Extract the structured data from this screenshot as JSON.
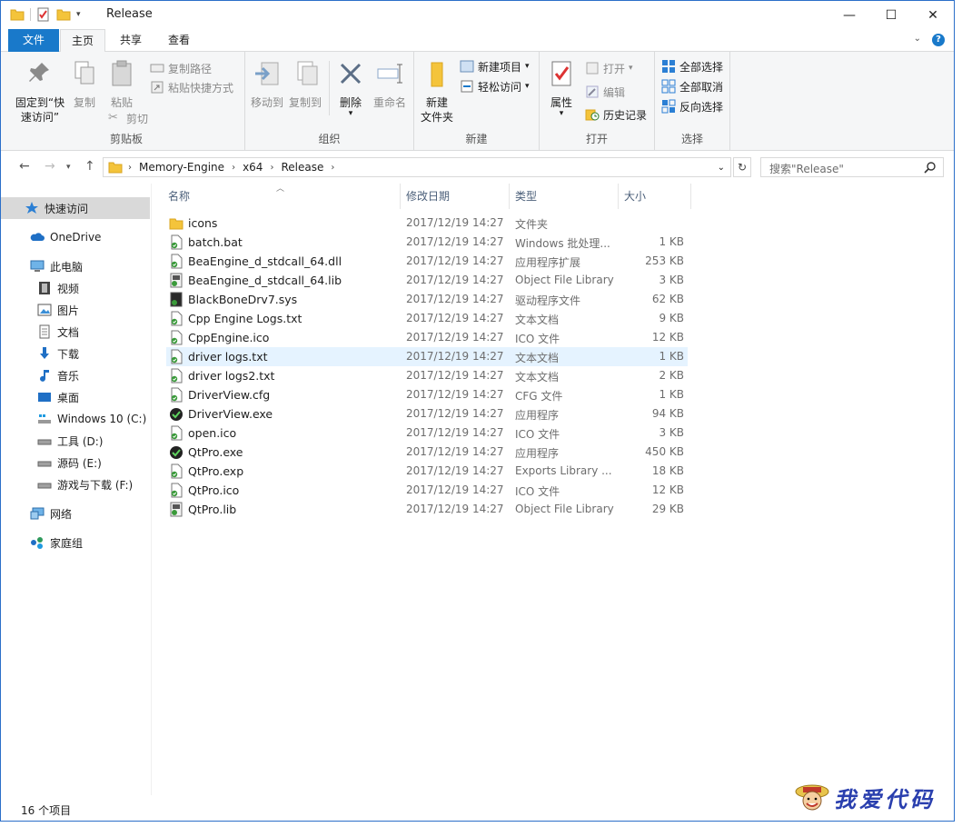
{
  "window": {
    "title": "Release"
  },
  "ribbon_tabs": {
    "file": "文件",
    "home": "主页",
    "share": "共享",
    "view": "查看"
  },
  "ribbon": {
    "clipboard": {
      "label": "剪贴板",
      "pin_line1": "固定到“快",
      "pin_line2": "速访问”",
      "copy": "复制",
      "paste": "粘贴",
      "copy_path": "复制路径",
      "paste_shortcut": "粘贴快捷方式",
      "cut": "剪切"
    },
    "organize": {
      "label": "组织",
      "move_to": "移动到",
      "copy_to": "复制到",
      "delete": "删除",
      "rename": "重命名"
    },
    "new": {
      "label": "新建",
      "new_folder_line1": "新建",
      "new_folder_line2": "文件夹",
      "new_item": "新建项目",
      "easy_access": "轻松访问"
    },
    "open": {
      "label": "打开",
      "properties": "属性",
      "open": "打开",
      "edit": "编辑",
      "history": "历史记录"
    },
    "select": {
      "label": "选择",
      "select_all": "全部选择",
      "select_none": "全部取消",
      "invert": "反向选择"
    }
  },
  "address": {
    "crumbs": [
      "Memory-Engine",
      "x64",
      "Release"
    ],
    "search_placeholder": "搜索\"Release\""
  },
  "nav": {
    "quick_access": "快速访问",
    "onedrive": "OneDrive",
    "this_pc": "此电脑",
    "videos": "视频",
    "pictures": "图片",
    "documents": "文档",
    "downloads": "下载",
    "music": "音乐",
    "desktop": "桌面",
    "drive_c": "Windows 10 (C:)",
    "drive_d": "工具 (D:)",
    "drive_e": "源码 (E:)",
    "drive_f": "游戏与下载 (F:)",
    "network": "网络",
    "homegroup": "家庭组"
  },
  "columns": {
    "name": "名称",
    "date": "修改日期",
    "type": "类型",
    "size": "大小"
  },
  "files": [
    {
      "name": "icons",
      "date": "2017/12/19 14:27",
      "type": "文件夹",
      "size": "",
      "icon": "folder-icon"
    },
    {
      "name": "batch.bat",
      "date": "2017/12/19 14:27",
      "type": "Windows 批处理...",
      "size": "1 KB",
      "icon": "batch-file-icon"
    },
    {
      "name": "BeaEngine_d_stdcall_64.dll",
      "date": "2017/12/19 14:27",
      "type": "应用程序扩展",
      "size": "253 KB",
      "icon": "dll-file-icon"
    },
    {
      "name": "BeaEngine_d_stdcall_64.lib",
      "date": "2017/12/19 14:27",
      "type": "Object File Library",
      "size": "3 KB",
      "icon": "lib-file-icon"
    },
    {
      "name": "BlackBoneDrv7.sys",
      "date": "2017/12/19 14:27",
      "type": "驱动程序文件",
      "size": "62 KB",
      "icon": "sys-file-icon"
    },
    {
      "name": "Cpp Engine Logs.txt",
      "date": "2017/12/19 14:27",
      "type": "文本文档",
      "size": "9 KB",
      "icon": "text-file-icon"
    },
    {
      "name": "CppEngine.ico",
      "date": "2017/12/19 14:27",
      "type": "ICO 文件",
      "size": "12 KB",
      "icon": "ico-file-icon"
    },
    {
      "name": "driver logs.txt",
      "date": "2017/12/19 14:27",
      "type": "文本文档",
      "size": "1 KB",
      "icon": "text-file-icon"
    },
    {
      "name": "driver logs2.txt",
      "date": "2017/12/19 14:27",
      "type": "文本文档",
      "size": "2 KB",
      "icon": "text-file-icon"
    },
    {
      "name": "DriverView.cfg",
      "date": "2017/12/19 14:27",
      "type": "CFG 文件",
      "size": "1 KB",
      "icon": "cfg-file-icon"
    },
    {
      "name": "DriverView.exe",
      "date": "2017/12/19 14:27",
      "type": "应用程序",
      "size": "94 KB",
      "icon": "exe-file-icon"
    },
    {
      "name": "open.ico",
      "date": "2017/12/19 14:27",
      "type": "ICO 文件",
      "size": "3 KB",
      "icon": "ico-file-icon"
    },
    {
      "name": "QtPro.exe",
      "date": "2017/12/19 14:27",
      "type": "应用程序",
      "size": "450 KB",
      "icon": "exe-file-icon"
    },
    {
      "name": "QtPro.exp",
      "date": "2017/12/19 14:27",
      "type": "Exports Library ...",
      "size": "18 KB",
      "icon": "exp-file-icon"
    },
    {
      "name": "QtPro.ico",
      "date": "2017/12/19 14:27",
      "type": "ICO 文件",
      "size": "12 KB",
      "icon": "ico-file-icon"
    },
    {
      "name": "QtPro.lib",
      "date": "2017/12/19 14:27",
      "type": "Object File Library",
      "size": "29 KB",
      "icon": "lib-file-icon"
    }
  ],
  "hover_row": 7,
  "status": {
    "count": "16 个项目"
  },
  "watermark": {
    "text": "我爱代码"
  },
  "colors": {
    "accent": "#1979ca",
    "hover": "#e5f3ff",
    "nav_selected": "#d9d9d9",
    "folder": "#f4c43b",
    "check_green": "#3a9a3a"
  }
}
